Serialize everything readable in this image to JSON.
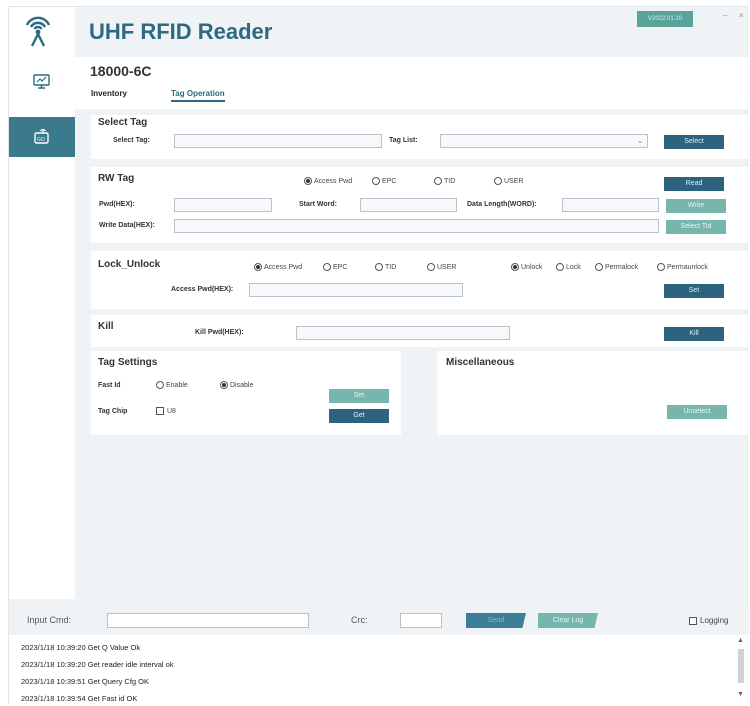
{
  "app": {
    "title": "UHF RFID Reader",
    "version": "V2022.01.10",
    "min_label": "–",
    "close_label": "×"
  },
  "sidebar": {
    "items": [
      {
        "icon": "monitor-settings-icon",
        "active": false
      },
      {
        "icon": "reader-tag-icon",
        "active": true
      }
    ]
  },
  "header": {
    "protocol": "18000-6C",
    "tabs": [
      {
        "label": "Inventory"
      },
      {
        "label": "Tag Operation"
      }
    ]
  },
  "select_tag": {
    "title": "Select Tag",
    "select_tag_label": "Select Tag:",
    "select_tag_value": "",
    "tag_list_label": "Tag List:",
    "tag_list_value": "",
    "select_button": "Select"
  },
  "rw_tag": {
    "title": "RW Tag",
    "areas": [
      "Access Pwd",
      "EPC",
      "TID",
      "USER"
    ],
    "pwd_label": "Pwd(HEX):",
    "start_word_label": "Start Word:",
    "data_length_label": "Data Length(WORD):",
    "write_data_label": "Write Data(HEX):",
    "read_button": "Read",
    "write_button": "Write",
    "select_tid_button": "Select Tid"
  },
  "lock_unlock": {
    "title": "Lock_Unlock",
    "areas": [
      "Access Pwd",
      "EPC",
      "TID",
      "USER"
    ],
    "modes": [
      "Unlock",
      "Lock",
      "Permalock",
      "Permaunlock"
    ],
    "access_pwd_label": "Access Pwd(HEX):",
    "set_button": "Set"
  },
  "kill": {
    "title": "Kill",
    "kill_pwd_label": "Kill Pwd(HEX):",
    "kill_button": "Kill"
  },
  "tag_settings": {
    "title": "Tag Settings",
    "fast_id_label": "Fast Id",
    "enable_label": "Enable",
    "disable_label": "Disable",
    "tag_chip_label": "Tag Chip",
    "u8_label": "U8",
    "set_button": "Set",
    "get_button": "Get"
  },
  "misc": {
    "title": "Miscellaneous",
    "unselect_button": "Unselect"
  },
  "bottom": {
    "input_cmd_label": "Input Cmd:",
    "crc_label": "Crc:",
    "send_button": "Send",
    "clear_log_button": "Clear Log",
    "logging_label": "Logging"
  },
  "log": {
    "lines": [
      "2023/1/18 10:39:20 Get Q Value Ok",
      "2023/1/18 10:39:20 Get reader idle interval ok",
      "2023/1/18 10:39:51 Get Query Cfg OK",
      "2023/1/18 10:39:54 Get Fast id OK"
    ]
  },
  "colors": {
    "accent": "#2d6a80",
    "button_dark": "#2e6380",
    "button_light": "#76b6ad",
    "sidebar_active": "#3a7a8c"
  }
}
